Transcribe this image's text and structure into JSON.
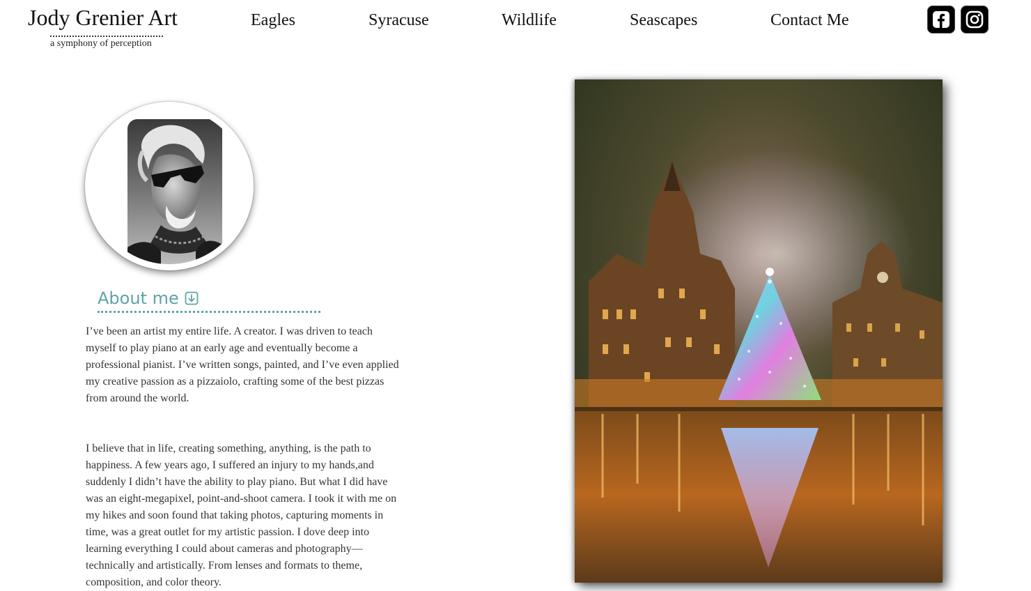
{
  "brand": {
    "title": "Jody Grenier Art",
    "tagline": "a symphony of perception"
  },
  "nav": {
    "items": [
      "Eagles",
      "Syracuse",
      "Wildlife",
      "Seascapes",
      "Contact Me"
    ]
  },
  "social": {
    "facebook_icon": "facebook-icon",
    "instagram_icon": "instagram-icon"
  },
  "about": {
    "heading": "About me",
    "icon": "arrow-down-box-icon",
    "paragraphs": [
      "I’ve been an artist my entire life. A creator. I was driven to teach myself to play piano at an early age and eventually become a professional pianist. I’ve written songs, painted, and I’ve even applied my creative passion as a pizzaiolo, crafting some of the best pizzas from around the world.",
      "I believe that in life, creating something, anything, is the path to happiness. A few years ago, I suffered an injury to my hands,and suddenly I didn’t have the ability to play piano. But what I did have was an eight-megapixel, point-and-shoot camera. I took it with me on my hikes and soon found that taking photos, capturing moments in time, was a great outlet for my artistic passion. I dove deep into learning everything I could about cameras and photography—technically and artistically. From lenses and formats to theme, composition, and color theory."
    ]
  },
  "colors": {
    "accent": "#5ea3a8",
    "text": "#333333",
    "social_bg": "#000000"
  }
}
